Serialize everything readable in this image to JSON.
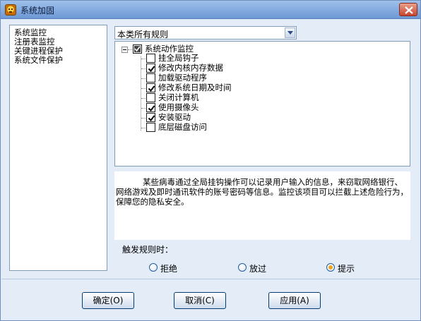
{
  "window": {
    "title": "系统加固"
  },
  "sidebar": {
    "items": [
      {
        "label": "系统监控"
      },
      {
        "label": "注册表监控"
      },
      {
        "label": "关键进程保护"
      },
      {
        "label": "系统文件保护"
      }
    ]
  },
  "rule_filter": {
    "selected": "本类所有规则"
  },
  "tree": {
    "root": {
      "label": "系统动作监控",
      "state": "partial"
    },
    "items": [
      {
        "label": "挂全局钩子",
        "checked": false
      },
      {
        "label": "修改内核内存数据",
        "checked": true
      },
      {
        "label": "加载驱动程序",
        "checked": false
      },
      {
        "label": "修改系统日期及时间",
        "checked": true
      },
      {
        "label": "关闭计算机",
        "checked": false
      },
      {
        "label": "使用摄像头",
        "checked": true
      },
      {
        "label": "安装驱动",
        "checked": true
      },
      {
        "label": "底层磁盘访问",
        "checked": false
      }
    ]
  },
  "description": "某些病毒通过全局挂钩操作可以记录用户输入的信息，来窃取网络银行、网络游戏及即时通讯软件的账号密码等信息。监控该项目可以拦截上述危险行为，保障您的隐私安全。",
  "trigger": {
    "label": "触发规则时：",
    "options": [
      {
        "label": "拒绝",
        "checked": false
      },
      {
        "label": "放过",
        "checked": false
      },
      {
        "label": "提示",
        "checked": true
      }
    ]
  },
  "buttons": {
    "ok": "确定(O)",
    "cancel": "取消(C)",
    "apply": "应用(A)"
  },
  "colors": {
    "accent": "#6d98d6",
    "check_orange": "#f2a21b"
  }
}
